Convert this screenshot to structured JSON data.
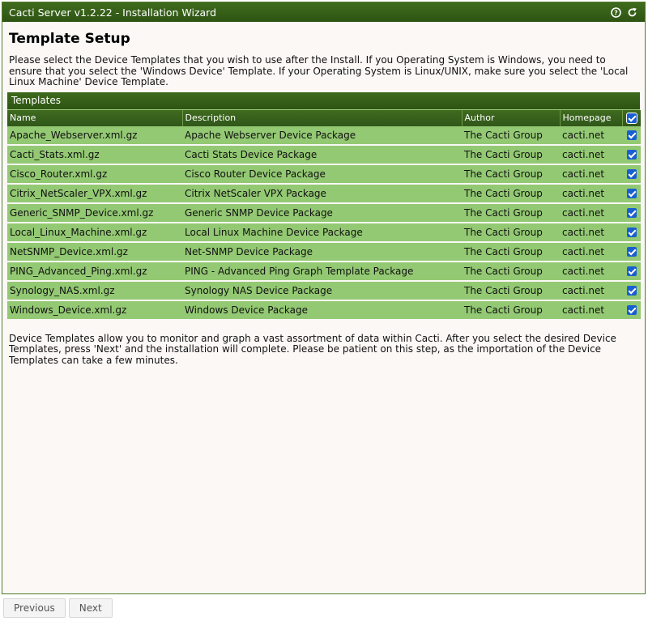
{
  "window": {
    "title": "Cacti Server v1.2.22 - Installation Wizard",
    "help_icon": "help-icon",
    "refresh_icon": "refresh-icon"
  },
  "page": {
    "title": "Template Setup",
    "intro": "Please select the Device Templates that you wish to use after the Install. If you Operating System is Windows, you need to ensure that you select the 'Windows Device' Template. If your Operating System is Linux/UNIX, make sure you select the 'Local Linux Machine' Device Template.",
    "outro": "Device Templates allow you to monitor and graph a vast assortment of data within Cacti. After you select the desired Device Templates, press 'Next' and the installation will complete. Please be patient on this step, as the importation of the Device Templates can take a few minutes."
  },
  "templates": {
    "panel_title": "Templates",
    "columns": {
      "name": "Name",
      "description": "Description",
      "author": "Author",
      "homepage": "Homepage"
    },
    "select_all_checked": true,
    "rows": [
      {
        "name": "Apache_Webserver.xml.gz",
        "description": "Apache Webserver Device Package",
        "author": "The Cacti Group",
        "homepage": "cacti.net",
        "checked": true
      },
      {
        "name": "Cacti_Stats.xml.gz",
        "description": "Cacti Stats Device Package",
        "author": "The Cacti Group",
        "homepage": "cacti.net",
        "checked": true
      },
      {
        "name": "Cisco_Router.xml.gz",
        "description": "Cisco Router Device Package",
        "author": "The Cacti Group",
        "homepage": "cacti.net",
        "checked": true
      },
      {
        "name": "Citrix_NetScaler_VPX.xml.gz",
        "description": "Citrix NetScaler VPX Package",
        "author": "The Cacti Group",
        "homepage": "cacti.net",
        "checked": true
      },
      {
        "name": "Generic_SNMP_Device.xml.gz",
        "description": "Generic SNMP Device Package",
        "author": "The Cacti Group",
        "homepage": "cacti.net",
        "checked": true
      },
      {
        "name": "Local_Linux_Machine.xml.gz",
        "description": "Local Linux Machine Device Package",
        "author": "The Cacti Group",
        "homepage": "cacti.net",
        "checked": true
      },
      {
        "name": "NetSNMP_Device.xml.gz",
        "description": "Net-SNMP Device Package",
        "author": "The Cacti Group",
        "homepage": "cacti.net",
        "checked": true
      },
      {
        "name": "PING_Advanced_Ping.xml.gz",
        "description": "PING - Advanced Ping Graph Template Package",
        "author": "The Cacti Group",
        "homepage": "cacti.net",
        "checked": true
      },
      {
        "name": "Synology_NAS.xml.gz",
        "description": "Synology NAS Device Package",
        "author": "The Cacti Group",
        "homepage": "cacti.net",
        "checked": true
      },
      {
        "name": "Windows_Device.xml.gz",
        "description": "Windows Device Package",
        "author": "The Cacti Group",
        "homepage": "cacti.net",
        "checked": true
      }
    ]
  },
  "footer": {
    "previous_label": "Previous",
    "next_label": "Next"
  },
  "colors": {
    "header_green": "#2e5514",
    "row_green": "#93c973",
    "checkbox_blue": "#1a5fd0"
  }
}
